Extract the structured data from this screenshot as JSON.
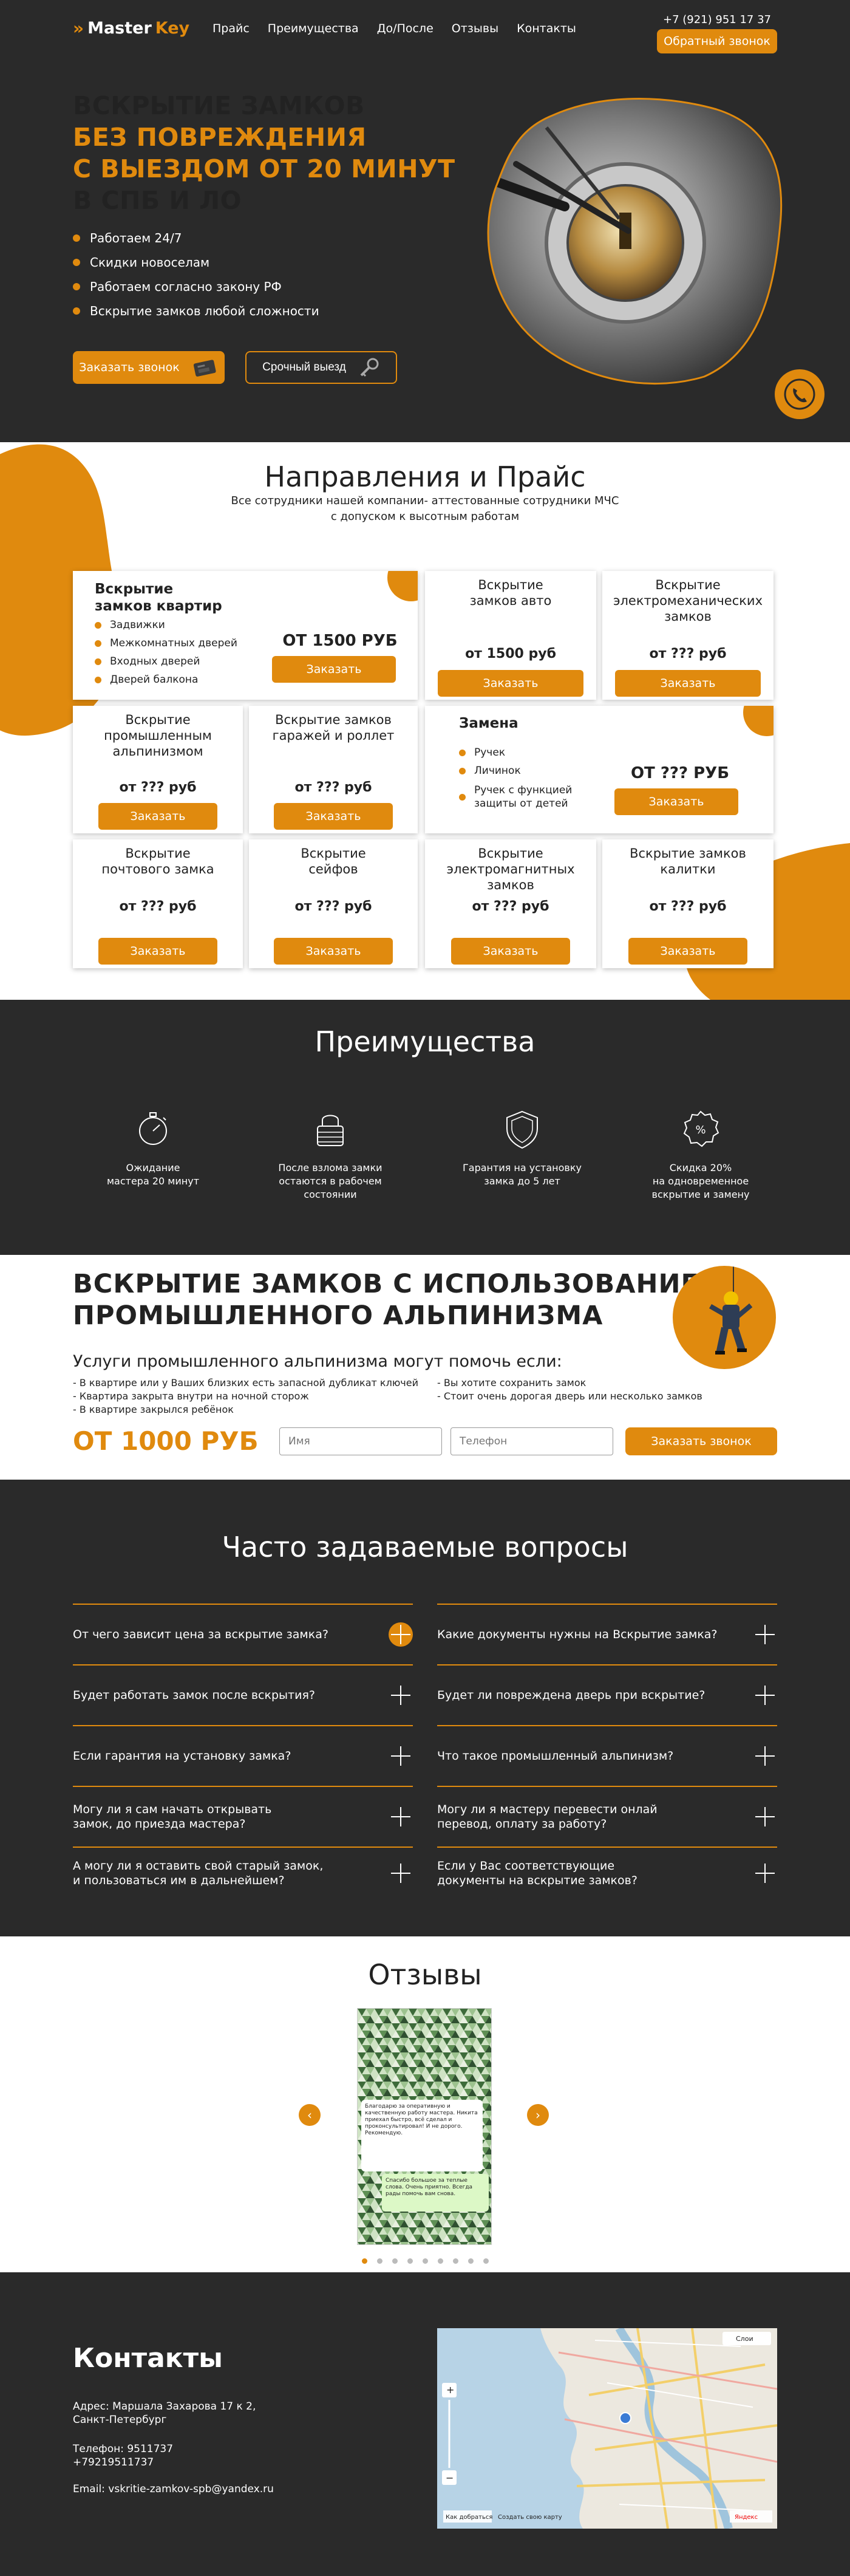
{
  "header": {
    "logo_part1": "Master",
    "logo_part2": "Key",
    "nav": [
      "Прайс",
      "Преимущества",
      "До/После",
      "Отзывы",
      "Контакты"
    ],
    "phone": "+7 (921) 951 17 37",
    "callback_label": "Обратный звонок"
  },
  "hero": {
    "title_line1": "ВСКРЫТИЕ ЗАМКОВ",
    "title_line2": "БЕЗ ПОВРЕЖДЕНИЯ",
    "title_line3": "С ВЫЕЗДОМ ОТ 20 МИНУТ",
    "title_line4": "В СПБ И ЛО",
    "bullets": [
      "Работаем 24/7",
      "Скидки новоселам",
      "Работаем согласно закону РФ",
      "Вскрытие замков любой сложности"
    ],
    "order_call_label": "Заказать звонок",
    "urgent_label": "Срочный выезд"
  },
  "prices": {
    "title": "Направления и Прайс",
    "subtitle_line1": "Все сотрудники нашей компании- аттестованные сотрудники МЧС",
    "subtitle_line2": "с допуском к высотным работам",
    "order_label": "Заказать",
    "big1": {
      "title_line1": "Вскрытие",
      "title_line2": "замков квартир",
      "items": [
        "Задвижки",
        "Межкомнатных дверей",
        "Входных дверей",
        "Дверей балкона"
      ],
      "price": "ОТ 1500 РУБ"
    },
    "big2": {
      "title": "Замена",
      "items": [
        "Ручек",
        "Личинок",
        "Ручек с функцией защиты от детей"
      ],
      "price": "ОТ ??? РУБ"
    },
    "cards": [
      {
        "title": "Вскрытие замков авто",
        "price": "от 1500 руб"
      },
      {
        "title": "Вскрытие электромеханических замков",
        "price": "от ??? руб"
      },
      {
        "title": "Вскрытие промышленным альпинизмом",
        "price": "от ??? руб"
      },
      {
        "title": "Вскрытие замков гаражей и роллет",
        "price": "от ??? руб"
      },
      {
        "title": "Вскрытие почтового замка",
        "price": "от ??? руб"
      },
      {
        "title": "Вскрытие сейфов",
        "price": "от ??? руб"
      },
      {
        "title": "Вскрытие электромагнитных замков",
        "price": "от ??? руб"
      },
      {
        "title": "Вскрытие замков калитки",
        "price": "от ??? руб"
      }
    ]
  },
  "advantages": {
    "title": "Преимущества",
    "items": [
      {
        "icon": "stopwatch-icon",
        "line1": "Ожидание",
        "line2": "мастера 20 минут",
        "line3": ""
      },
      {
        "icon": "padlock-icon",
        "line1": "После взлома замки",
        "line2": "остаются в рабочем",
        "line3": "состоянии"
      },
      {
        "icon": "shield-check-icon",
        "line1": "Гарантия на установку",
        "line2": "замка до 5 лет",
        "line3": ""
      },
      {
        "icon": "discount-badge-icon",
        "line1": "Скидка 20%",
        "line2": "на одновременное",
        "line3": "вскрытие и замену"
      }
    ]
  },
  "alpinism": {
    "title_line1": "ВСКРЫТИЕ ЗАМКОВ С ИСПОЛЬЗОВАНИЕМ",
    "title_line2": "ПРОМЫШЛЕННОГО АЛЬПИНИЗМА",
    "subtitle": "Услуги промышленного альпинизма могут помочь если:",
    "list_left": [
      "- В квартире или у Ваших близких есть запасной  дубликат ключей",
      "- Квартира закрыта внутри на ночной сторож",
      "- В квартире закрылся ребёнок"
    ],
    "list_right": [
      "- Вы хотите сохранить замок",
      "- Стоит очень дорогая дверь или несколько замков"
    ],
    "price": "ОТ 1000 РУБ",
    "name_placeholder": "Имя",
    "phone_placeholder": "Телефон",
    "order_label": "Заказать звонок"
  },
  "faq": {
    "title": "Часто задаваемые вопросы",
    "left": [
      "От чего зависит цена за вскрытие замка?",
      "Будет работать замок после вскрытия?",
      "Если  гарантия на установку замка?",
      "Могу ли я сам начать открывать замок, до приезда мастера?",
      "А могу ли я оставить свой старый замок, и пользоваться им в дальнейшем?"
    ],
    "right": [
      "Какие документы нужны на Вскрытие замка?",
      "Будет ли повреждена дверь при вскрытие?",
      "Что такое промышленный альпинизм?",
      "Могу ли я мастеру перевести онлай перевод, оплату за работу?",
      "Если у Вас соответствующие документы на вскрытие замков?"
    ]
  },
  "reviews": {
    "title": "Отзывы",
    "prev": "‹",
    "next": "›",
    "slide_count": 9,
    "active_slide": 1,
    "chat_text1": "Благодарю за оперативную и качественную работу мастера. Никита приехал быстро, всё сделал и проконсультировал! И не дорого. Рекомендую.",
    "chat_text2": "Спасибо большое за теплые слова. Очень приятно. Всегда рады помочь вам снова."
  },
  "contacts": {
    "title": "Контакты",
    "address_line1": "Адрес: Маршала Захарова 17 к 2,",
    "address_line2": "Санкт-Петербург",
    "phone_line1": "Телефон: 9511737",
    "phone_line2": "+79219511737",
    "email": "Email: vskritie-zamkov-spb@yandex.ru",
    "map_open_label": "Как добраться",
    "map_create_label": "Создать свою карту",
    "map_zoom_in": "+",
    "map_zoom_out": "−",
    "map_layer_label": "Слои",
    "map_brand": "Яндекс"
  },
  "colors": {
    "accent": "#e08a0e",
    "dark": "#2a2a2a"
  }
}
